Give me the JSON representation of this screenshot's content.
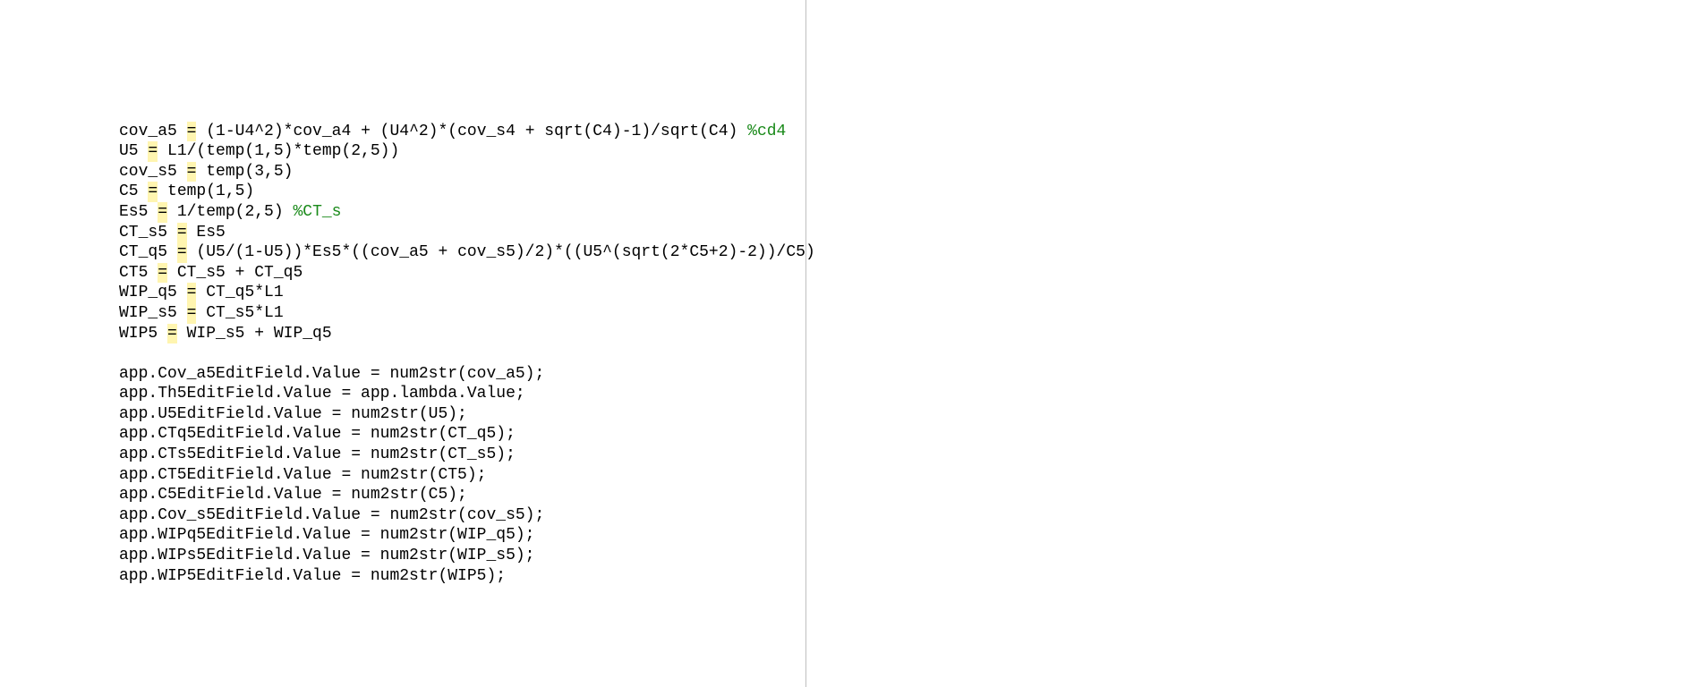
{
  "code": {
    "lines": [
      {
        "pre": "cov_a5 ",
        "eq": "=",
        "post": " (1-U4^2)*cov_a4 + (U4^2)*(cov_s4 + sqrt(C4)-1)/sqrt(C4) ",
        "comment": "%cd4"
      },
      {
        "pre": "U5 ",
        "eq": "=",
        "post": " L1/(temp(1,5)*temp(2,5))",
        "comment": ""
      },
      {
        "pre": "cov_s5 ",
        "eq": "=",
        "post": " temp(3,5)",
        "comment": ""
      },
      {
        "pre": "C5 ",
        "eq": "=",
        "post": " temp(1,5)",
        "comment": ""
      },
      {
        "pre": "Es5 ",
        "eq": "=",
        "post": " 1/temp(2,5) ",
        "comment": "%CT_s"
      },
      {
        "pre": "CT_s5 ",
        "eq": "=",
        "post": " Es5",
        "comment": ""
      },
      {
        "pre": "CT_q5 ",
        "eq": "=",
        "post": " (U5/(1-U5))*Es5*((cov_a5 + cov_s5)/2)*((U5^(sqrt(2*C5+2)-2))/C5)",
        "comment": ""
      },
      {
        "pre": "CT5 ",
        "eq": "=",
        "post": " CT_s5 + CT_q5",
        "comment": ""
      },
      {
        "pre": "WIP_q5 ",
        "eq": "=",
        "post": " CT_q5*L1",
        "comment": ""
      },
      {
        "pre": "WIP_s5 ",
        "eq": "=",
        "post": " CT_s5*L1",
        "comment": ""
      },
      {
        "pre": "WIP5 ",
        "eq": "=",
        "post": " WIP_s5 + WIP_q5",
        "comment": ""
      },
      {
        "pre": "",
        "eq": "",
        "post": "",
        "comment": ""
      },
      {
        "pre": "app.Cov_a5EditField.Value = num2str(cov_a5);",
        "eq": "",
        "post": "",
        "comment": ""
      },
      {
        "pre": "app.Th5EditField.Value = app.lambda.Value;",
        "eq": "",
        "post": "",
        "comment": ""
      },
      {
        "pre": "app.U5EditField.Value = num2str(U5);",
        "eq": "",
        "post": "",
        "comment": ""
      },
      {
        "pre": "app.CTq5EditField.Value = num2str(CT_q5);",
        "eq": "",
        "post": "",
        "comment": ""
      },
      {
        "pre": "app.CTs5EditField.Value = num2str(CT_s5);",
        "eq": "",
        "post": "",
        "comment": ""
      },
      {
        "pre": "app.CT5EditField.Value = num2str(CT5);",
        "eq": "",
        "post": "",
        "comment": ""
      },
      {
        "pre": "app.C5EditField.Value = num2str(C5);",
        "eq": "",
        "post": "",
        "comment": ""
      },
      {
        "pre": "app.Cov_s5EditField.Value = num2str(cov_s5);",
        "eq": "",
        "post": "",
        "comment": ""
      },
      {
        "pre": "app.WIPq5EditField.Value = num2str(WIP_q5);",
        "eq": "",
        "post": "",
        "comment": ""
      },
      {
        "pre": "app.WIPs5EditField.Value = num2str(WIP_s5);",
        "eq": "",
        "post": "",
        "comment": ""
      },
      {
        "pre": "app.WIP5EditField.Value = num2str(WIP5);",
        "eq": "",
        "post": "",
        "comment": ""
      }
    ]
  }
}
